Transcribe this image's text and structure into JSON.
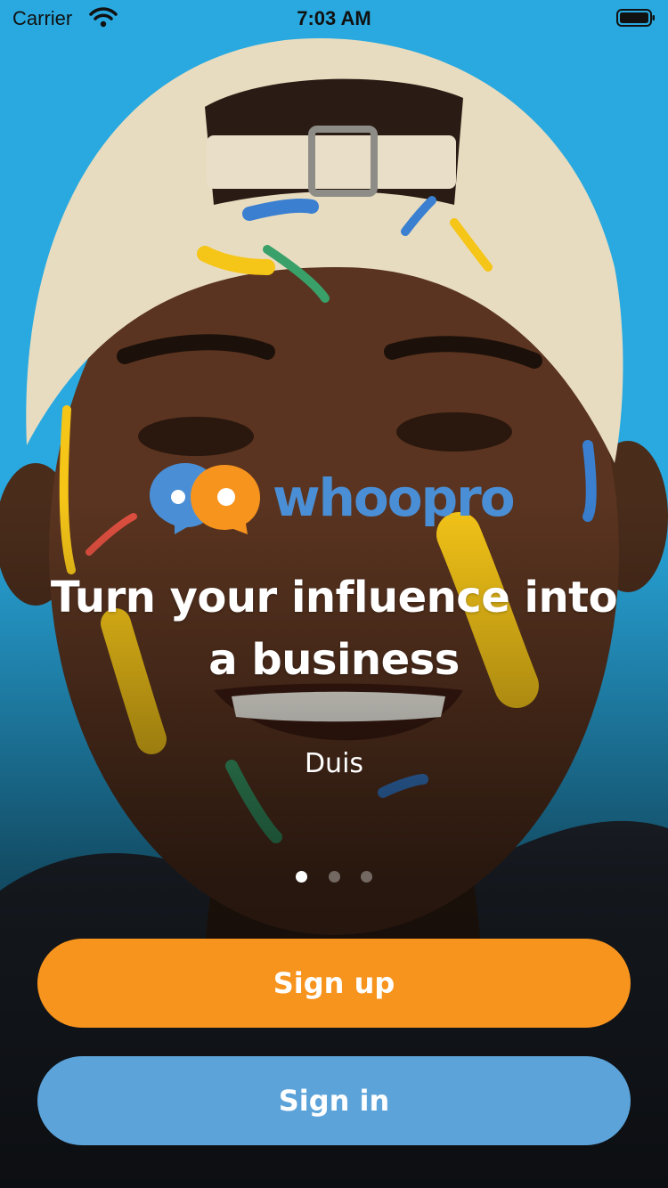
{
  "status_bar": {
    "carrier": "Carrier",
    "time": "7:03 AM"
  },
  "brand": {
    "name": "whoopro",
    "blue": "#4a8fd6",
    "orange": "#f7941e"
  },
  "hero": {
    "headline_line1": "Turn your influence into",
    "headline_line2": "a business",
    "subtitle": "Duis"
  },
  "pager": {
    "total": 3,
    "active_index": 0
  },
  "actions": {
    "signup_label": "Sign up",
    "signin_label": "Sign in",
    "signup_color": "#f7941e",
    "signin_color": "#5ca3da"
  },
  "background": {
    "color": "#29a9df"
  }
}
